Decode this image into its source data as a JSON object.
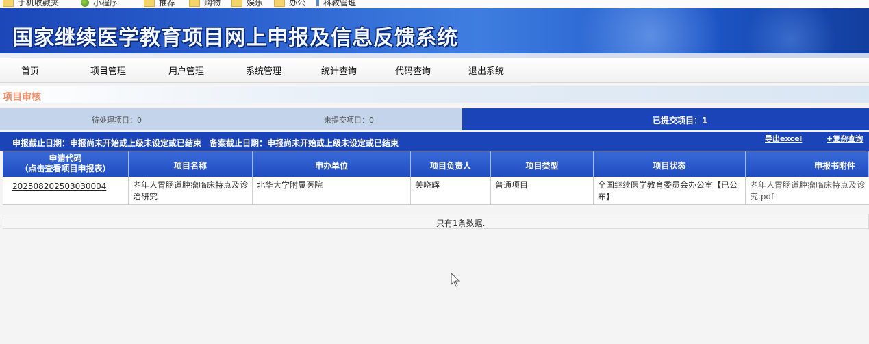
{
  "bookmarks": [
    {
      "label": "手机收藏夹",
      "icon": "folder-icon"
    },
    {
      "label": "小程序",
      "icon": "app-icon"
    },
    {
      "label": "推荐",
      "icon": "folder-icon"
    },
    {
      "label": "购物",
      "icon": "folder-icon"
    },
    {
      "label": "娱乐",
      "icon": "folder-icon"
    },
    {
      "label": "办公",
      "icon": "folder-icon"
    },
    {
      "label": "科教管理",
      "icon": "page-icon"
    }
  ],
  "banner": {
    "title": "国家继续医学教育项目网上申报及信息反馈系统"
  },
  "nav": {
    "items": [
      "首页",
      "项目管理",
      "用户管理",
      "系统管理",
      "统计查询",
      "代码查询",
      "退出系统"
    ]
  },
  "section": {
    "title": "项目审核"
  },
  "stats": {
    "pending": "待处理项目：0",
    "unsubmitted": "未提交项目：0",
    "submitted": "已提交项目：1"
  },
  "deadline": {
    "text": "申报截止日期：申报尚未开始或上级未设定或已结束　备案截止日期：申报尚未开始或上级未设定或已结束",
    "export_label": "导出excel",
    "complex_query_label": "+复杂查询"
  },
  "table": {
    "headers": [
      {
        "line1": "申请代码",
        "line2": "（点击查看项目申报表）"
      },
      {
        "line1": "项目名称",
        "line2": ""
      },
      {
        "line1": "申办单位",
        "line2": ""
      },
      {
        "line1": "项目负责人",
        "line2": ""
      },
      {
        "line1": "项目类型",
        "line2": ""
      },
      {
        "line1": "项目状态",
        "line2": ""
      },
      {
        "line1": "申报书附件",
        "line2": ""
      }
    ],
    "rows": [
      {
        "code": "202508202503030004",
        "name": "老年人胃肠道肿瘤临床特点及诊治研究",
        "org": "北华大学附属医院",
        "leader": "关晓辉",
        "type": "普通项目",
        "status": "全国继续医学教育委员会办公室【已公布】",
        "attachment": "老年人胃肠道肿瘤临床特点及诊究.pdf"
      }
    ],
    "footer": "只有1条数据."
  },
  "colors": {
    "primary_blue": "#1a44b8",
    "header_blue": "#2a55cc",
    "stat_light": "#c4d4ea",
    "section_title": "#f08f6a"
  }
}
